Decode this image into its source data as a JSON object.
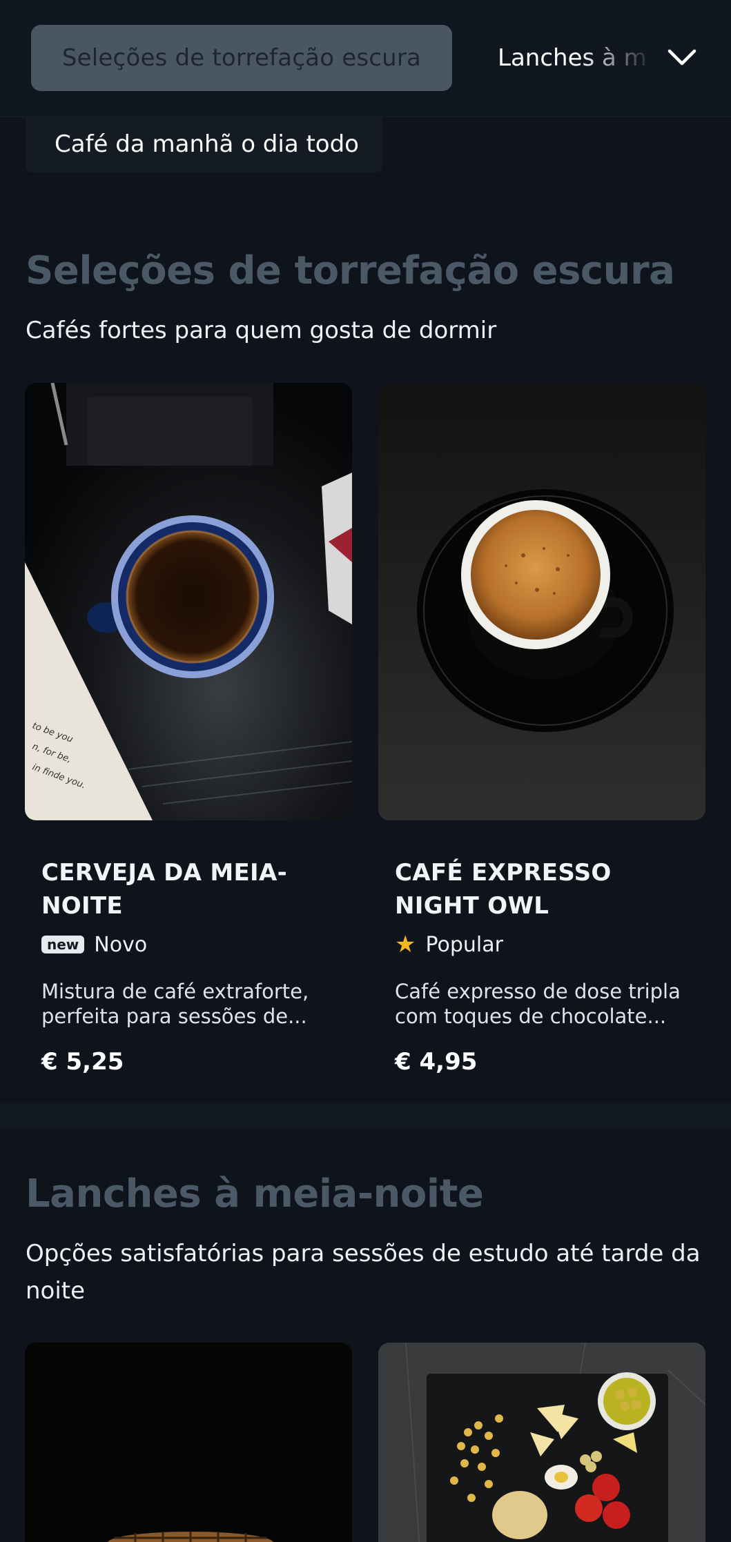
{
  "category_nav": {
    "active_label": "Seleções de torrefação escura",
    "next_label": "Lanches à meia-noite",
    "chevron_icon": "chevron-down-icon",
    "row2_label": "Café da manhã o dia todo"
  },
  "sections": [
    {
      "title": "Seleções de torrefação escura",
      "subtitle": "Cafés fortes para quem gosta de dormir",
      "items": [
        {
          "name": "CERVEJA DA MEIA-NOITE",
          "badge_type": "new",
          "badge_tag": "new",
          "badge_label": "Novo",
          "description": "Mistura de café extraforte, perfeita para sessões de...",
          "price": "€ 5,25"
        },
        {
          "name": "CAFÉ EXPRESSO NIGHT OWL",
          "badge_type": "popular",
          "badge_icon": "star-icon",
          "badge_label": "Popular",
          "description": "Café expresso de dose tripla com toques de chocolate...",
          "price": "€ 4,95"
        }
      ]
    },
    {
      "title": "Lanches à meia-noite",
      "subtitle": "Opções satisfatórias para sessões de estudo até tarde da noite"
    }
  ],
  "colors": {
    "background": "#0f141c",
    "active_chip": "#4a5664",
    "section_title": "#4b5866",
    "star": "#f5b722"
  }
}
